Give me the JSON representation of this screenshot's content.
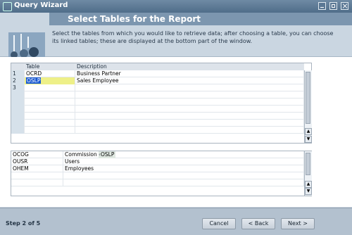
{
  "window": {
    "title": "Query Wizard",
    "icon": "window-app-icon"
  },
  "header": {
    "heading": "Select Tables for the Report",
    "description": "Select the tables from which you would like to retrieve data; after choosing a table, you can choose its linked tables; these are displayed at the bottom part of the window."
  },
  "selected_tables": {
    "columns": [
      "Table",
      "Description"
    ],
    "rows": [
      {
        "num": "1",
        "table": "OCRD",
        "description": "Business Partner"
      },
      {
        "num": "2",
        "table": "OSLP",
        "description": "Sales Employee"
      },
      {
        "num": "3",
        "table": "",
        "description": ""
      },
      {
        "num": "",
        "table": "",
        "description": ""
      },
      {
        "num": "",
        "table": "",
        "description": ""
      },
      {
        "num": "",
        "table": "",
        "description": ""
      },
      {
        "num": "",
        "table": "",
        "description": ""
      },
      {
        "num": "",
        "table": "",
        "description": ""
      },
      {
        "num": "",
        "table": "",
        "description": ""
      }
    ]
  },
  "linked_tables": {
    "rows": [
      {
        "table": "OCOG",
        "description": "Commission",
        "linked_from": "OSLP"
      },
      {
        "table": "OUSR",
        "description": "Users",
        "linked_from": ""
      },
      {
        "table": "OHEM",
        "description": "Employees",
        "linked_from": ""
      },
      {
        "table": "",
        "description": "",
        "linked_from": ""
      },
      {
        "table": "",
        "description": "",
        "linked_from": ""
      }
    ]
  },
  "footer": {
    "step": "Step 2 of 5",
    "cancel_label": "Cancel",
    "back_label": "< Back",
    "next_label": "Next >"
  },
  "colors": {
    "titlebar": "#4f6d89",
    "header_banner": "#7c96af",
    "selection_highlight": "#1c5bd2",
    "footer": "#b3c1cf"
  }
}
